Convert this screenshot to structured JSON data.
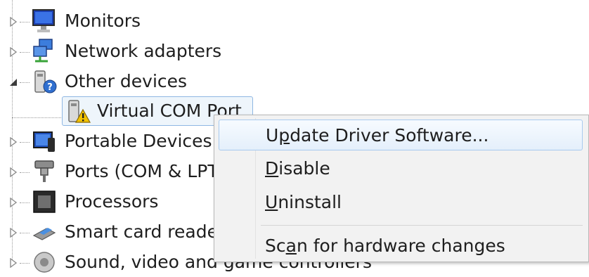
{
  "tree": {
    "items": [
      {
        "label": "Monitors",
        "icon": "monitor-icon",
        "expanded": false
      },
      {
        "label": "Network adapters",
        "icon": "network-adapter-icon",
        "expanded": false
      },
      {
        "label": "Other devices",
        "icon": "other-devices-icon",
        "expanded": true
      },
      {
        "label": "Virtual COM Port",
        "icon": "unknown-device-warning-icon",
        "selected": true
      },
      {
        "label": "Portable Devices",
        "icon": "portable-device-icon",
        "expanded": false
      },
      {
        "label": "Ports (COM & LPT)",
        "icon": "port-icon",
        "expanded": false
      },
      {
        "label": "Processors",
        "icon": "processor-icon",
        "expanded": false
      },
      {
        "label": "Smart card readers",
        "icon": "smart-card-reader-icon",
        "expanded": false
      },
      {
        "label": "Sound, video and game controllers",
        "icon": "sound-icon",
        "expanded": false
      }
    ]
  },
  "context_menu": {
    "items": [
      {
        "pre": "U",
        "accel": "p",
        "post": "date Driver Software..."
      },
      {
        "pre": "",
        "accel": "D",
        "post": "isable"
      },
      {
        "pre": "",
        "accel": "U",
        "post": "ninstall"
      },
      {
        "pre": "Sc",
        "accel": "a",
        "post": "n for hardware changes"
      }
    ]
  },
  "colors": {
    "selection_border": "#8fb7e3",
    "selection_fill": "#eef5fb",
    "menu_bg": "#f2f2f2",
    "warning": "#f2c200"
  }
}
